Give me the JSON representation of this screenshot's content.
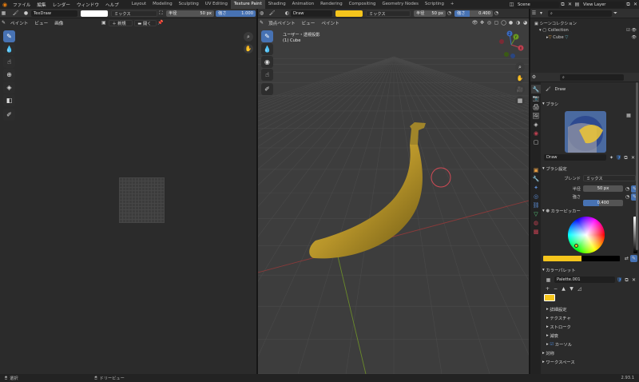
{
  "topbar": {
    "menus": [
      "ファイル",
      "編集",
      "レンダー",
      "ウィンドウ",
      "ヘルプ"
    ],
    "workspaces": [
      "Layout",
      "Modeling",
      "Sculpting",
      "UV Editing",
      "Texture Paint",
      "Shading",
      "Animation",
      "Rendering",
      "Compositing",
      "Geometry Nodes",
      "Scripting"
    ],
    "active_workspace": "Texture Paint",
    "scene": "Scene",
    "view_layer": "View Layer"
  },
  "image_editor": {
    "texture_name": "TexDraw",
    "blend": "ミックス",
    "radius_label": "半径",
    "radius_value": "50 px",
    "strength_label": "強さ",
    "strength_value": "1.000",
    "menus": [
      "ペイント",
      "ビュー",
      "画像"
    ],
    "new_label": "新規",
    "open_label": "開く"
  },
  "viewport": {
    "brush_name": "Draw",
    "blend": "ミックス",
    "radius_label": "半径",
    "radius_value": "50 px",
    "strength_label": "強さ",
    "strength_value": "0.400",
    "menus": [
      "頂点ペイント",
      "ビュー",
      "ペイント"
    ],
    "view_name": "ユーザー・透視投影",
    "object_name": "(1) Cube",
    "gizmo": {
      "x": "X",
      "y": "Y",
      "z": "Z"
    }
  },
  "outliner": {
    "title": "シーンコレクション",
    "collection": "Collection",
    "cube": "Cube"
  },
  "properties": {
    "brush_name": "Draw",
    "brush_panel": "ブラシ",
    "brush_settings": "ブラシ設定",
    "blend_label": "ブレンド",
    "blend_value": "ミックス",
    "radius_label": "半径",
    "radius_value": "50 px",
    "strength_label": "強さ",
    "strength_value": "0.400",
    "strength_fraction": 0.4,
    "color_picker": "カラーピッカー",
    "color_palette": "カラーパレット",
    "palette_name": "Palette.001",
    "subpanels": [
      "詳細設定",
      "テクスチャ",
      "ストローク",
      "減衰",
      "カーソル"
    ],
    "footer_panels": [
      "対称",
      "ワークスペース"
    ],
    "brush_color": "#f5c51c"
  },
  "statusbar": {
    "select": "選択",
    "tree_view": "ドリービュー",
    "version": "2.93.1"
  },
  "colors": {
    "accent": "#4772b3",
    "banana": "#c9a42a",
    "selection_circle": "#d04a55"
  }
}
